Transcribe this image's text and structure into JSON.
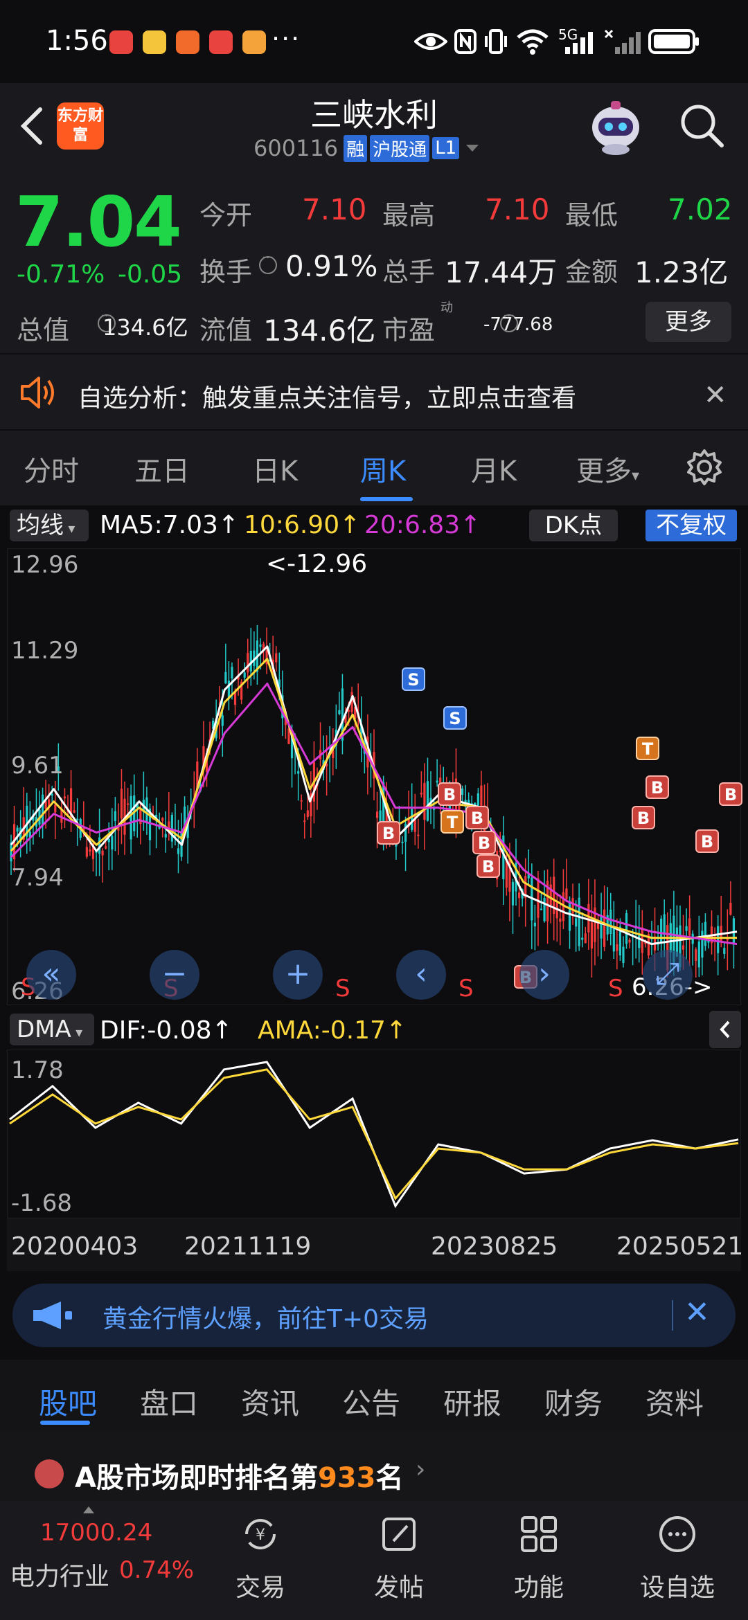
{
  "status_bar": {
    "time": "1:56",
    "dots": "···",
    "network": "5G"
  },
  "header": {
    "logo_text": "东方财富",
    "stock_name": "三峡水利",
    "stock_code": "600116",
    "tags": [
      "融",
      "沪股通",
      "L1"
    ]
  },
  "quote": {
    "price": "7.04",
    "change_pct": "-0.71%",
    "change": "-0.05",
    "fields": {
      "open_label": "今开",
      "open": "7.10",
      "high_label": "最高",
      "high": "7.10",
      "low_label": "最低",
      "low": "7.02",
      "turnover_label": "换手",
      "turnover": "0.91%",
      "volume_label": "总手",
      "volume": "17.44万",
      "amount_label": "金额",
      "amount": "1.23亿",
      "mcap_label": "总值",
      "mcap": "134.6亿",
      "float_label": "流值",
      "float": "134.6亿",
      "pe_label": "市盈",
      "pe_sup": "动",
      "pe": "-777.68"
    },
    "more_label": "更多"
  },
  "banner": {
    "text": "自选分析：触发重点关注信号，立即点击查看",
    "close": "✕"
  },
  "tabs": [
    {
      "label": "分时"
    },
    {
      "label": "五日"
    },
    {
      "label": "日K"
    },
    {
      "label": "周K"
    },
    {
      "label": "月K"
    },
    {
      "label": "更多"
    }
  ],
  "active_tab": "周K",
  "chart": {
    "ma_selector": "均线",
    "ma5": "MA5:7.03↑",
    "ma10": "10:6.90↑",
    "ma20": "20:6.83↑",
    "dk_label": "DK点",
    "adjust_label": "不复权",
    "y_labels": [
      "12.96",
      "11.29",
      "9.61",
      "7.94",
      "6.26"
    ],
    "high_marker": "<-12.96",
    "low_marker": "6.26->",
    "s_marker": "S",
    "signals": [
      "S",
      "S",
      "B",
      "B",
      "T",
      "B",
      "B",
      "B",
      "T",
      "B",
      "B",
      "B",
      "B",
      "B"
    ],
    "dma_selector": "DMA",
    "dif": "DIF:-0.08↑",
    "ama": "AMA:-0.17↑",
    "dma_y_labels": [
      "1.78",
      "-1.68"
    ],
    "dates": [
      "20200403",
      "20211119",
      "20230825",
      "20250521"
    ],
    "colors": {
      "ma5": "#ffffff",
      "ma10": "#ffd93b",
      "ma20": "#d63ad6",
      "up": "#f33b3b",
      "down": "#23c8c8"
    }
  },
  "chart_data": {
    "type": "line",
    "series": [
      {
        "name": "MA5",
        "values": [
          8.4,
          9.3,
          8.3,
          9.1,
          8.4,
          10.9,
          11.6,
          9.1,
          10.8,
          8.5,
          9.2,
          9.0,
          7.6,
          7.3,
          7.1,
          6.8,
          6.9,
          7.0
        ]
      },
      {
        "name": "MA10",
        "values": [
          8.3,
          9.1,
          8.4,
          9.0,
          8.5,
          10.7,
          11.4,
          9.3,
          10.5,
          8.7,
          9.1,
          9.0,
          7.8,
          7.4,
          7.1,
          6.9,
          6.9,
          6.9
        ]
      },
      {
        "name": "MA20",
        "values": [
          8.2,
          8.9,
          8.6,
          8.8,
          8.6,
          10.2,
          11.0,
          9.7,
          10.3,
          9.0,
          9.0,
          8.9,
          8.0,
          7.5,
          7.2,
          7.0,
          6.9,
          6.8
        ]
      }
    ],
    "ylim": [
      6.26,
      12.96
    ],
    "x_labels": [
      "20200403",
      "20211119",
      "20230825",
      "20250521"
    ]
  },
  "promo": {
    "text": "黄金行情火爆，前往T+0交易"
  },
  "bottom_tabs": [
    {
      "label": "股吧"
    },
    {
      "label": "盘口"
    },
    {
      "label": "资讯"
    },
    {
      "label": "公告"
    },
    {
      "label": "研报"
    },
    {
      "label": "财务"
    },
    {
      "label": "资料"
    }
  ],
  "rank": {
    "prefix": "A股市场即时排名第",
    "number": "933",
    "suffix": "名"
  },
  "bottom_nav": {
    "index_value": "17000.24",
    "index_name": "电力行业",
    "index_pct": "0.74%",
    "items": [
      {
        "label": "交易",
        "icon": "trade-icon"
      },
      {
        "label": "发帖",
        "icon": "post-icon"
      },
      {
        "label": "功能",
        "icon": "apps-icon"
      },
      {
        "label": "设自选",
        "icon": "add-watch-icon"
      }
    ]
  }
}
